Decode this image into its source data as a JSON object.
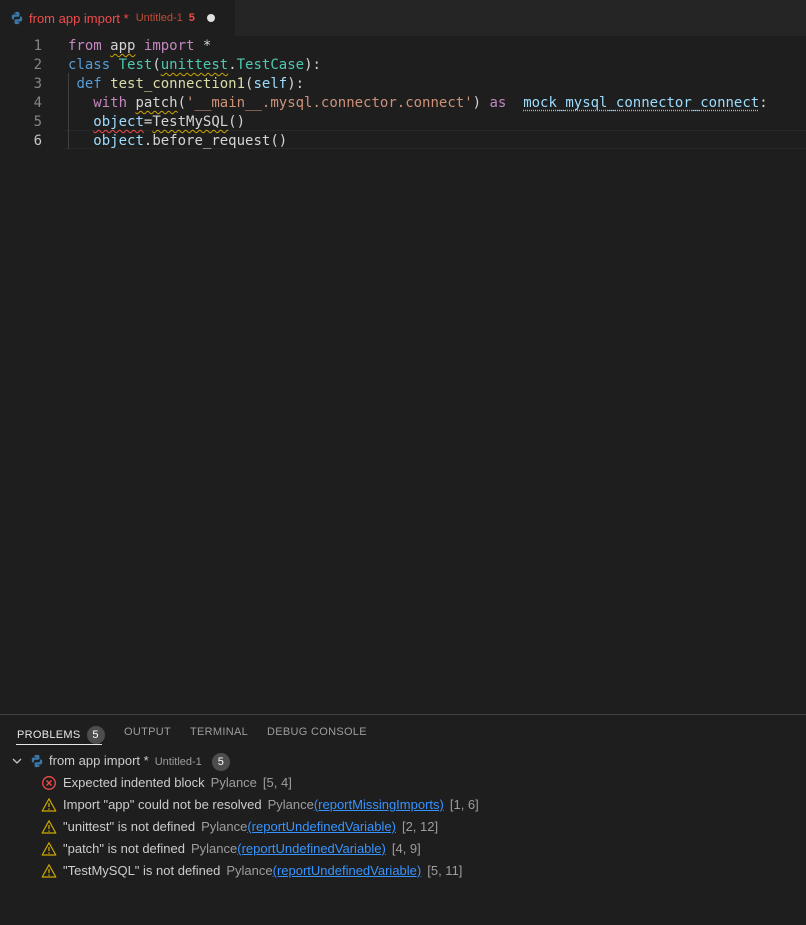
{
  "tab": {
    "title": "from app import *",
    "description": "Untitled-1",
    "problem_count": "5",
    "icon": "python-icon"
  },
  "editor": {
    "line_numbers": [
      "1",
      "2",
      "3",
      "4",
      "5",
      "6"
    ],
    "active_line": 6,
    "lines": [
      [
        {
          "t": "from",
          "c": "kwc"
        },
        {
          "t": " "
        },
        {
          "t": "app",
          "c": "squig-w"
        },
        {
          "t": " "
        },
        {
          "t": "import",
          "c": "kwc"
        },
        {
          "t": " *"
        }
      ],
      [
        {
          "t": "class",
          "c": "kw"
        },
        {
          "t": " "
        },
        {
          "t": "Test",
          "c": "cls"
        },
        {
          "t": "("
        },
        {
          "t": "unittest",
          "c": "cls squig-w"
        },
        {
          "t": "."
        },
        {
          "t": "TestCase",
          "c": "cls"
        },
        {
          "t": "):"
        }
      ],
      [
        {
          "t": " "
        },
        {
          "t": "def",
          "c": "kw"
        },
        {
          "t": " "
        },
        {
          "t": "test_connection1",
          "c": "fn"
        },
        {
          "t": "("
        },
        {
          "t": "self",
          "c": "var"
        },
        {
          "t": "):"
        }
      ],
      [
        {
          "t": "   "
        },
        {
          "t": "with",
          "c": "kwc"
        },
        {
          "t": " "
        },
        {
          "t": "patch",
          "c": "squig-w"
        },
        {
          "t": "("
        },
        {
          "t": "'__main__.mysql.connector.connect'",
          "c": "str"
        },
        {
          "t": ") "
        },
        {
          "t": "as",
          "c": "kwc"
        },
        {
          "t": "  "
        },
        {
          "t": "mock_mysql_connector_connect",
          "c": "var dotted"
        },
        {
          "t": ":"
        }
      ],
      [
        {
          "t": "   "
        },
        {
          "t": "object",
          "c": "var squig-e"
        },
        {
          "t": "="
        },
        {
          "t": "TestMySQL",
          "c": "squig-w"
        },
        {
          "t": "()"
        }
      ],
      [
        {
          "t": "   "
        },
        {
          "t": "object",
          "c": "var"
        },
        {
          "t": "."
        },
        {
          "t": "before_request"
        },
        {
          "t": "()"
        }
      ]
    ]
  },
  "panel": {
    "tabs": [
      {
        "label": "PROBLEMS",
        "badge": "5",
        "active": true
      },
      {
        "label": "OUTPUT"
      },
      {
        "label": "TERMINAL"
      },
      {
        "label": "DEBUG CONSOLE"
      }
    ],
    "group": {
      "label": "from app import *",
      "description": "Untitled-1",
      "count": "5"
    },
    "problems": [
      {
        "severity": "error",
        "message": "Expected indented block",
        "source": "Pylance",
        "code": "",
        "position": "[5, 4]"
      },
      {
        "severity": "warning",
        "message": "Import \"app\" could not be resolved",
        "source": "Pylance",
        "code": "reportMissingImports",
        "position": "[1, 6]"
      },
      {
        "severity": "warning",
        "message": "\"unittest\" is not defined",
        "source": "Pylance",
        "code": "reportUndefinedVariable",
        "position": "[2, 12]"
      },
      {
        "severity": "warning",
        "message": "\"patch\" is not defined",
        "source": "Pylance",
        "code": "reportUndefinedVariable",
        "position": "[4, 9]"
      },
      {
        "severity": "warning",
        "message": "\"TestMySQL\" is not defined",
        "source": "Pylance",
        "code": "reportUndefinedVariable",
        "position": "[5, 11]"
      }
    ]
  },
  "colors": {
    "error": "#f14c4c",
    "warning": "#cca700",
    "link": "#3794ff"
  }
}
